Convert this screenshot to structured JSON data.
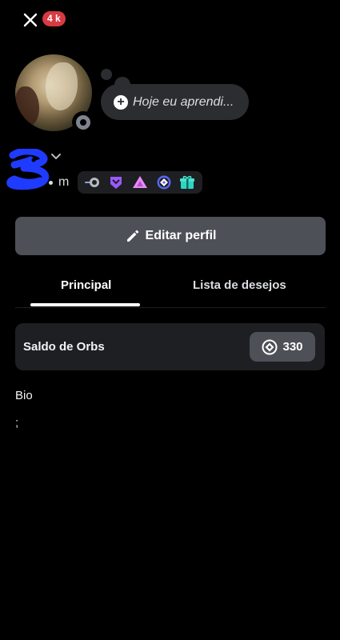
{
  "header": {
    "notification_badge": "4 k"
  },
  "profile": {
    "status_placeholder": "Hoje eu aprendi...",
    "pronoun_suffix": "m"
  },
  "badges": [
    "hypesquad-orbit-icon",
    "shield-badge-icon",
    "triangle-badge-icon",
    "quest-badge-icon",
    "gift-badge-icon"
  ],
  "actions": {
    "edit_profile": "Editar perfil"
  },
  "tabs": [
    {
      "label": "Principal",
      "active": true
    },
    {
      "label": "Lista de desejos",
      "active": false
    }
  ],
  "orbs": {
    "label": "Saldo de Orbs",
    "balance": "330"
  },
  "bio": {
    "title": "Bio",
    "text": ";"
  },
  "colors": {
    "background": "#000000",
    "card": "#1e1f22",
    "button": "#4e5058",
    "bubble": "#2b2d31",
    "badge_red": "#d83a42",
    "scribble_blue": "#1f3bff"
  }
}
